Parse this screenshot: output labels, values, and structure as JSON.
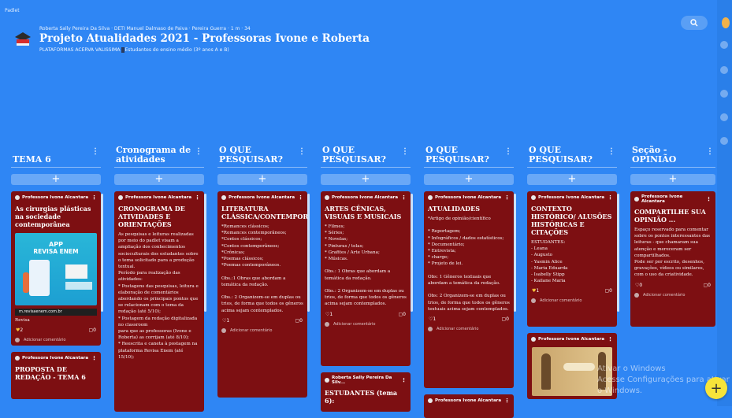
{
  "app": {
    "tag": "Padlet"
  },
  "header": {
    "author_line": "Roberta Sally Pereira Da Silva · DETI Manuel Dalmaso de Paiva · Pereira Guerra · 1 m · 34",
    "title": "Projeto Atualidades 2021 - Professoras Ivone e Roberta",
    "subtitle_pre": "PLATAFORMAS ACERVA VALISSIMA",
    "subtitle_badge": "",
    "subtitle_post": "Estudantes do ensino médio (3º anos A e B)"
  },
  "columns": [
    {
      "title": "TEMA 6"
    },
    {
      "title": "Cronograma de atividades"
    },
    {
      "title": "O QUE PESQUISAR?"
    },
    {
      "title": "O QUE PESQUISAR?"
    },
    {
      "title": "O QUE PESQUISAR?"
    },
    {
      "title": "O QUE PESQUISAR?"
    },
    {
      "title": "Seção - OPINIÃO"
    }
  ],
  "add_label": "+",
  "author_ivone": "Professora Ivone Alcantara",
  "author_roberta": "Roberta Sally Pereira Da Silv...",
  "add_comment": "Adicionar comentário",
  "cards": {
    "c1": {
      "title": "As cirurgias plásticas na sociedade contemporânea",
      "app_t1": "APP",
      "app_t2": "REVISA ENEM",
      "url": "m.revisaenem.com.br",
      "meta": "Revisa",
      "likes": "2",
      "comments": "0"
    },
    "c1b": {
      "title": "PROPOSTA DE REDAÇÃO - TEMA 6"
    },
    "c2": {
      "title": "CRONOGRAMA DE ATIVIDADES E ORIENTAÇÕES",
      "body": "As pesquisas e leituras realizadas por meio do padlet visam a ampliação dos conhecimentos socioculturais dos estudantes sobre o tema solicitado para a produção textual.\nPeríodo para realização das atividades:\n* Postagens das pesquisas, leitura e elaboração de comentários abordando os principais pontos que se relacionam com o tema da redação (até 5/10);\n* Postagem da redação digitalizada no classroom\npara que as professoras (Ivone e Roberta) as corrijam (até 8/10);\n* Reescrita e caneta à postagem na plataforma Revisa Enem (até 15/10);"
    },
    "c3": {
      "title": "LITERATURA CLÁSSICA/CONTEMPORÂNEA",
      "body": "*Romances clássicos;\n*Romances contemporâneos;\n*Contos clássicos;\n*Contos contemporâneos;\n*Crônicas;\n*Poemas clássicos;\n*Poemas contemporâneos.\n\nObs.:1 Obras que abordam a temática da redação.\n\nObs.: 2  Organizem-se em duplas ou trios, de forma que todos os gêneros acima sejam contemplados.",
      "likes": "1",
      "comments": "0"
    },
    "c4": {
      "title": "ARTES CÊNICAS, VISUAIS E MUSICAIS",
      "body": "* Filmes;\n* Séries;\n* Novelas;\n* Pinturas / telas;\n* Grafites / Arte Urbana;\n* Músicas.\n\nObs.: 1 Obras que abordam a temática da redação.\n\nObs.: 2  Organizem-se em duplas ou trios, de forma que todos os gêneros acima sejam contemplados.",
      "likes": "1",
      "comments": "0"
    },
    "c4b": {
      "title": "ESTUDANTES (tema 6):"
    },
    "c5": {
      "title": "ATUALIDADES",
      "body": "*Artigo de opinião/científico\n\n* Reportagem;\n* Infográficos / dados estatísticos;\n* Documentário;\n* Entrevista;\n* charge;\n* Projeto de lei.\n\nObs: 1  Gêneros textuais que abordam a temática da redação.\n\nObs: 2  Organizem-se em duplas ou trios, de forma que todos os gêneros textuais acima sejam contemplados.",
      "likes": "1",
      "comments": "0"
    },
    "c6": {
      "title": "CONTEXTO HISTÓRICO/ ALUSÕES HISTÓRICAS E CITAÇÕES",
      "body": "ESTUDANTES:\n- Leana\n- Augusto\n- Yasmin Alice\n- Maria Eduarda\n- Isabelly Stipp\n- Kailane Maria",
      "likes": "1",
      "comments": "0"
    },
    "c7": {
      "title": "COMPARTILHE SUA OPINIÃO ...",
      "body": "Espaço reservado para comentar sobre   os pontos interessantes das leituras - que chamaram sua atenção e mereceram ser compartilhados.\nPode ser por escrito, desenhos, gravações, vídeos ou similares, com o uso da criatividade.",
      "likes": "0",
      "comments": "0"
    }
  },
  "watermark": {
    "line1": "Ativar o Windows",
    "line2": "Acesse Configurações para ativar o Windows."
  },
  "fab_label": "+",
  "colors": {
    "background": "#2f86f4",
    "card": "#7d0f12",
    "fab": "#f7e43a"
  }
}
